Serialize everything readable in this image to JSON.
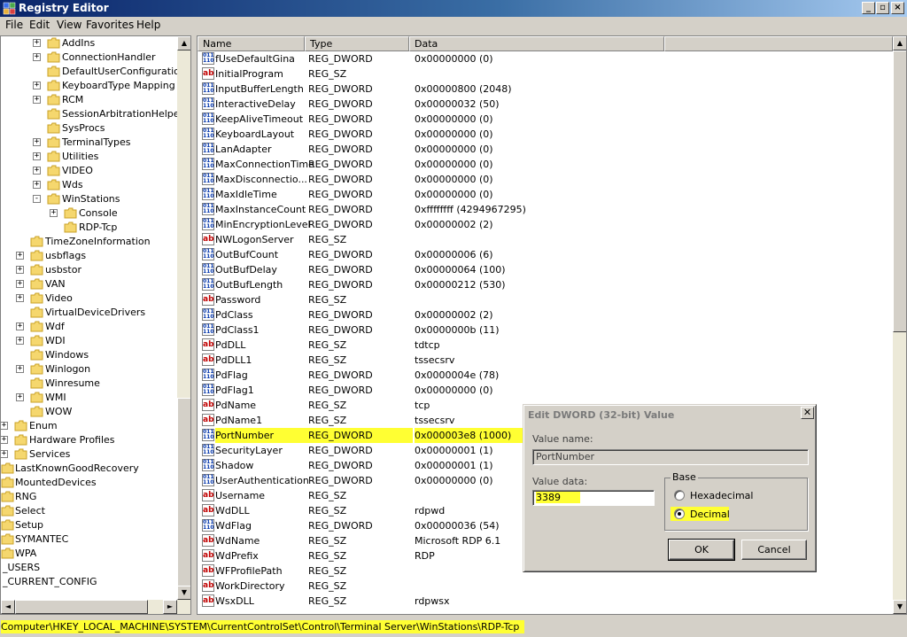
{
  "window": {
    "title": "Registry Editor"
  },
  "menu": [
    "File",
    "Edit",
    "View",
    "Favorites",
    "Help"
  ],
  "tree": [
    {
      "label": "AddIns",
      "expander": "+",
      "level": 3
    },
    {
      "label": "ConnectionHandler",
      "expander": "+",
      "level": 3
    },
    {
      "label": "DefaultUserConfiguration",
      "expander": "",
      "level": 3
    },
    {
      "label": "KeyboardType Mapping",
      "expander": "+",
      "level": 3
    },
    {
      "label": "RCM",
      "expander": "+",
      "level": 3
    },
    {
      "label": "SessionArbitrationHelper",
      "expander": "",
      "level": 3
    },
    {
      "label": "SysProcs",
      "expander": "",
      "level": 3
    },
    {
      "label": "TerminalTypes",
      "expander": "+",
      "level": 3
    },
    {
      "label": "Utilities",
      "expander": "+",
      "level": 3
    },
    {
      "label": "VIDEO",
      "expander": "+",
      "level": 3
    },
    {
      "label": "Wds",
      "expander": "+",
      "level": 3
    },
    {
      "label": "WinStations",
      "expander": "-",
      "level": 3
    },
    {
      "label": "Console",
      "expander": "+",
      "level": 4
    },
    {
      "label": "RDP-Tcp",
      "expander": "",
      "level": 4
    },
    {
      "label": "TimeZoneInformation",
      "expander": "",
      "level": 2
    },
    {
      "label": "usbflags",
      "expander": "+",
      "level": 2
    },
    {
      "label": "usbstor",
      "expander": "+",
      "level": 2
    },
    {
      "label": "VAN",
      "expander": "+",
      "level": 2
    },
    {
      "label": "Video",
      "expander": "+",
      "level": 2
    },
    {
      "label": "VirtualDeviceDrivers",
      "expander": "",
      "level": 2
    },
    {
      "label": "Wdf",
      "expander": "+",
      "level": 2
    },
    {
      "label": "WDI",
      "expander": "+",
      "level": 2
    },
    {
      "label": "Windows",
      "expander": "",
      "level": 2
    },
    {
      "label": "Winlogon",
      "expander": "+",
      "level": 2
    },
    {
      "label": "Winresume",
      "expander": "",
      "level": 2
    },
    {
      "label": "WMI",
      "expander": "+",
      "level": 2
    },
    {
      "label": "WOW",
      "expander": "",
      "level": 2
    },
    {
      "label": "Enum",
      "expander": "+",
      "level": 1
    },
    {
      "label": "Hardware Profiles",
      "expander": "+",
      "level": 1
    },
    {
      "label": "Services",
      "expander": "+",
      "level": 1
    },
    {
      "label": "LastKnownGoodRecovery",
      "expander": "",
      "level": 0
    },
    {
      "label": "MountedDevices",
      "expander": "",
      "level": 0
    },
    {
      "label": "RNG",
      "expander": "",
      "level": 0
    },
    {
      "label": "Select",
      "expander": "",
      "level": 0
    },
    {
      "label": "Setup",
      "expander": "",
      "level": 0
    },
    {
      "label": "SYMANTEC",
      "expander": "",
      "level": 0
    },
    {
      "label": "WPA",
      "expander": "",
      "level": 0
    },
    {
      "label": "_USERS",
      "expander": "",
      "level": -1
    },
    {
      "label": "_CURRENT_CONFIG",
      "expander": "",
      "level": -1
    }
  ],
  "list": {
    "columns": [
      "Name",
      "Type",
      "Data"
    ],
    "rows": [
      {
        "name": "fUseDefaultGina",
        "type": "REG_DWORD",
        "data": "0x00000000 (0)"
      },
      {
        "name": "InitialProgram",
        "type": "REG_SZ",
        "data": ""
      },
      {
        "name": "InputBufferLength",
        "type": "REG_DWORD",
        "data": "0x00000800 (2048)"
      },
      {
        "name": "InteractiveDelay",
        "type": "REG_DWORD",
        "data": "0x00000032 (50)"
      },
      {
        "name": "KeepAliveTimeout",
        "type": "REG_DWORD",
        "data": "0x00000000 (0)"
      },
      {
        "name": "KeyboardLayout",
        "type": "REG_DWORD",
        "data": "0x00000000 (0)"
      },
      {
        "name": "LanAdapter",
        "type": "REG_DWORD",
        "data": "0x00000000 (0)"
      },
      {
        "name": "MaxConnectionTime",
        "type": "REG_DWORD",
        "data": "0x00000000 (0)"
      },
      {
        "name": "MaxDisconnectio...",
        "type": "REG_DWORD",
        "data": "0x00000000 (0)"
      },
      {
        "name": "MaxIdleTime",
        "type": "REG_DWORD",
        "data": "0x00000000 (0)"
      },
      {
        "name": "MaxInstanceCount",
        "type": "REG_DWORD",
        "data": "0xffffffff (4294967295)"
      },
      {
        "name": "MinEncryptionLevel",
        "type": "REG_DWORD",
        "data": "0x00000002 (2)"
      },
      {
        "name": "NWLogonServer",
        "type": "REG_SZ",
        "data": ""
      },
      {
        "name": "OutBufCount",
        "type": "REG_DWORD",
        "data": "0x00000006 (6)"
      },
      {
        "name": "OutBufDelay",
        "type": "REG_DWORD",
        "data": "0x00000064 (100)"
      },
      {
        "name": "OutBufLength",
        "type": "REG_DWORD",
        "data": "0x00000212 (530)"
      },
      {
        "name": "Password",
        "type": "REG_SZ",
        "data": ""
      },
      {
        "name": "PdClass",
        "type": "REG_DWORD",
        "data": "0x00000002 (2)"
      },
      {
        "name": "PdClass1",
        "type": "REG_DWORD",
        "data": "0x0000000b (11)"
      },
      {
        "name": "PdDLL",
        "type": "REG_SZ",
        "data": "tdtcp"
      },
      {
        "name": "PdDLL1",
        "type": "REG_SZ",
        "data": "tssecsrv"
      },
      {
        "name": "PdFlag",
        "type": "REG_DWORD",
        "data": "0x0000004e (78)"
      },
      {
        "name": "PdFlag1",
        "type": "REG_DWORD",
        "data": "0x00000000 (0)"
      },
      {
        "name": "PdName",
        "type": "REG_SZ",
        "data": "tcp"
      },
      {
        "name": "PdName1",
        "type": "REG_SZ",
        "data": "tssecsrv"
      },
      {
        "name": "PortNumber",
        "type": "REG_DWORD",
        "data": "0x000003e8 (1000)",
        "highlight": true
      },
      {
        "name": "SecurityLayer",
        "type": "REG_DWORD",
        "data": "0x00000001 (1)"
      },
      {
        "name": "Shadow",
        "type": "REG_DWORD",
        "data": "0x00000001 (1)"
      },
      {
        "name": "UserAuthentication",
        "type": "REG_DWORD",
        "data": "0x00000000 (0)"
      },
      {
        "name": "Username",
        "type": "REG_SZ",
        "data": ""
      },
      {
        "name": "WdDLL",
        "type": "REG_SZ",
        "data": "rdpwd"
      },
      {
        "name": "WdFlag",
        "type": "REG_DWORD",
        "data": "0x00000036 (54)"
      },
      {
        "name": "WdName",
        "type": "REG_SZ",
        "data": "Microsoft RDP 6.1"
      },
      {
        "name": "WdPrefix",
        "type": "REG_SZ",
        "data": "RDP"
      },
      {
        "name": "WFProfilePath",
        "type": "REG_SZ",
        "data": ""
      },
      {
        "name": "WorkDirectory",
        "type": "REG_SZ",
        "data": ""
      },
      {
        "name": "WsxDLL",
        "type": "REG_SZ",
        "data": "rdpwsx"
      }
    ]
  },
  "status": {
    "path": "Computer\\HKEY_LOCAL_MACHINE\\SYSTEM\\CurrentControlSet\\Control\\Terminal Server\\WinStations\\RDP-Tcp"
  },
  "dialog": {
    "title": "Edit DWORD (32-bit) Value",
    "close": "✕",
    "value_name_label": "Value name:",
    "value_name": "PortNumber",
    "value_data_label": "Value data:",
    "value_data": "3389",
    "base_label": "Base",
    "hex_label": "Hexadecimal",
    "dec_label": "Decimal",
    "ok": "OK",
    "cancel": "Cancel"
  },
  "colors": {
    "highlight": "#ffff33",
    "titlebar_start": "#0a246a"
  }
}
